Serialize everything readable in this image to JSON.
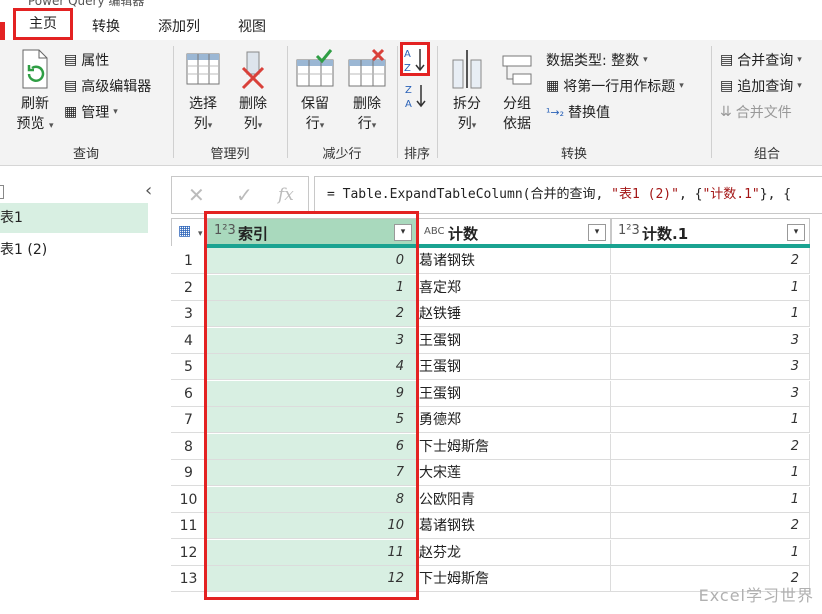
{
  "window": {
    "title": "Power Query 编辑器"
  },
  "tabs": [
    "主页",
    "转换",
    "添加列",
    "视图"
  ],
  "ribbon": {
    "query_group": {
      "label": "查询",
      "refresh": "刷新\n预览",
      "refresh_line1": "刷新",
      "refresh_line2": "预览",
      "properties": "属性",
      "advanced_editor": "高级编辑器",
      "manage": "管理"
    },
    "manage_columns_group": {
      "label": "管理列",
      "choose_line1": "选择",
      "choose_line2": "列",
      "remove_line1": "删除",
      "remove_line2": "列"
    },
    "reduce_rows_group": {
      "label": "减少行",
      "keep_line1": "保留",
      "keep_line2": "行",
      "remove_line1": "删除",
      "remove_line2": "行"
    },
    "sort_group": {
      "label": "排序"
    },
    "transform_group": {
      "label": "转换",
      "split_line1": "拆分",
      "split_line2": "列",
      "group_line1": "分组",
      "group_line2": "依据",
      "data_type": "数据类型: 整数",
      "first_row_header": "将第一行用作标题",
      "replace_values": "替换值"
    },
    "combine_group": {
      "label": "组合",
      "merge_queries": "合并查询",
      "append_queries": "追加查询",
      "combine_files": "合并文件"
    }
  },
  "queries": [
    "表1",
    "表1 (2)"
  ],
  "formula_bar": {
    "prefix": "= Table.ExpandTableColumn(合并的查询, ",
    "arg1": "\"表1 (2)\"",
    "sep": ", {",
    "arg2": "\"计数.1\"",
    "suffix": "}, {"
  },
  "columns": [
    {
      "type_icon": "1²3",
      "name": "索引"
    },
    {
      "type_icon": "ABC",
      "name": "计数"
    },
    {
      "type_icon": "1²3",
      "name": "计数.1"
    }
  ],
  "rows": [
    {
      "n": "1",
      "idx": "0",
      "cnt": "葛诸钢铁",
      "cnt1": "2"
    },
    {
      "n": "2",
      "idx": "1",
      "cnt": "喜定郑",
      "cnt1": "1"
    },
    {
      "n": "3",
      "idx": "2",
      "cnt": "赵铁锤",
      "cnt1": "1"
    },
    {
      "n": "4",
      "idx": "3",
      "cnt": "王蛋钢",
      "cnt1": "3"
    },
    {
      "n": "5",
      "idx": "4",
      "cnt": "王蛋钢",
      "cnt1": "3"
    },
    {
      "n": "6",
      "idx": "9",
      "cnt": "王蛋钢",
      "cnt1": "3"
    },
    {
      "n": "7",
      "idx": "5",
      "cnt": "勇德郑",
      "cnt1": "1"
    },
    {
      "n": "8",
      "idx": "6",
      "cnt": "下士姆斯詹",
      "cnt1": "2"
    },
    {
      "n": "9",
      "idx": "7",
      "cnt": "大宋莲",
      "cnt1": "1"
    },
    {
      "n": "10",
      "idx": "8",
      "cnt": "公欧阳青",
      "cnt1": "1"
    },
    {
      "n": "11",
      "idx": "10",
      "cnt": "葛诸钢铁",
      "cnt1": "2"
    },
    {
      "n": "12",
      "idx": "11",
      "cnt": "赵芬龙",
      "cnt1": "1"
    },
    {
      "n": "13",
      "idx": "12",
      "cnt": "下士姆斯詹",
      "cnt1": "2"
    }
  ],
  "watermark": "Excel学习世界",
  "colors": {
    "highlight": "#e32222",
    "selected_col": "#d8efe2",
    "header_bar": "#1aa391"
  }
}
